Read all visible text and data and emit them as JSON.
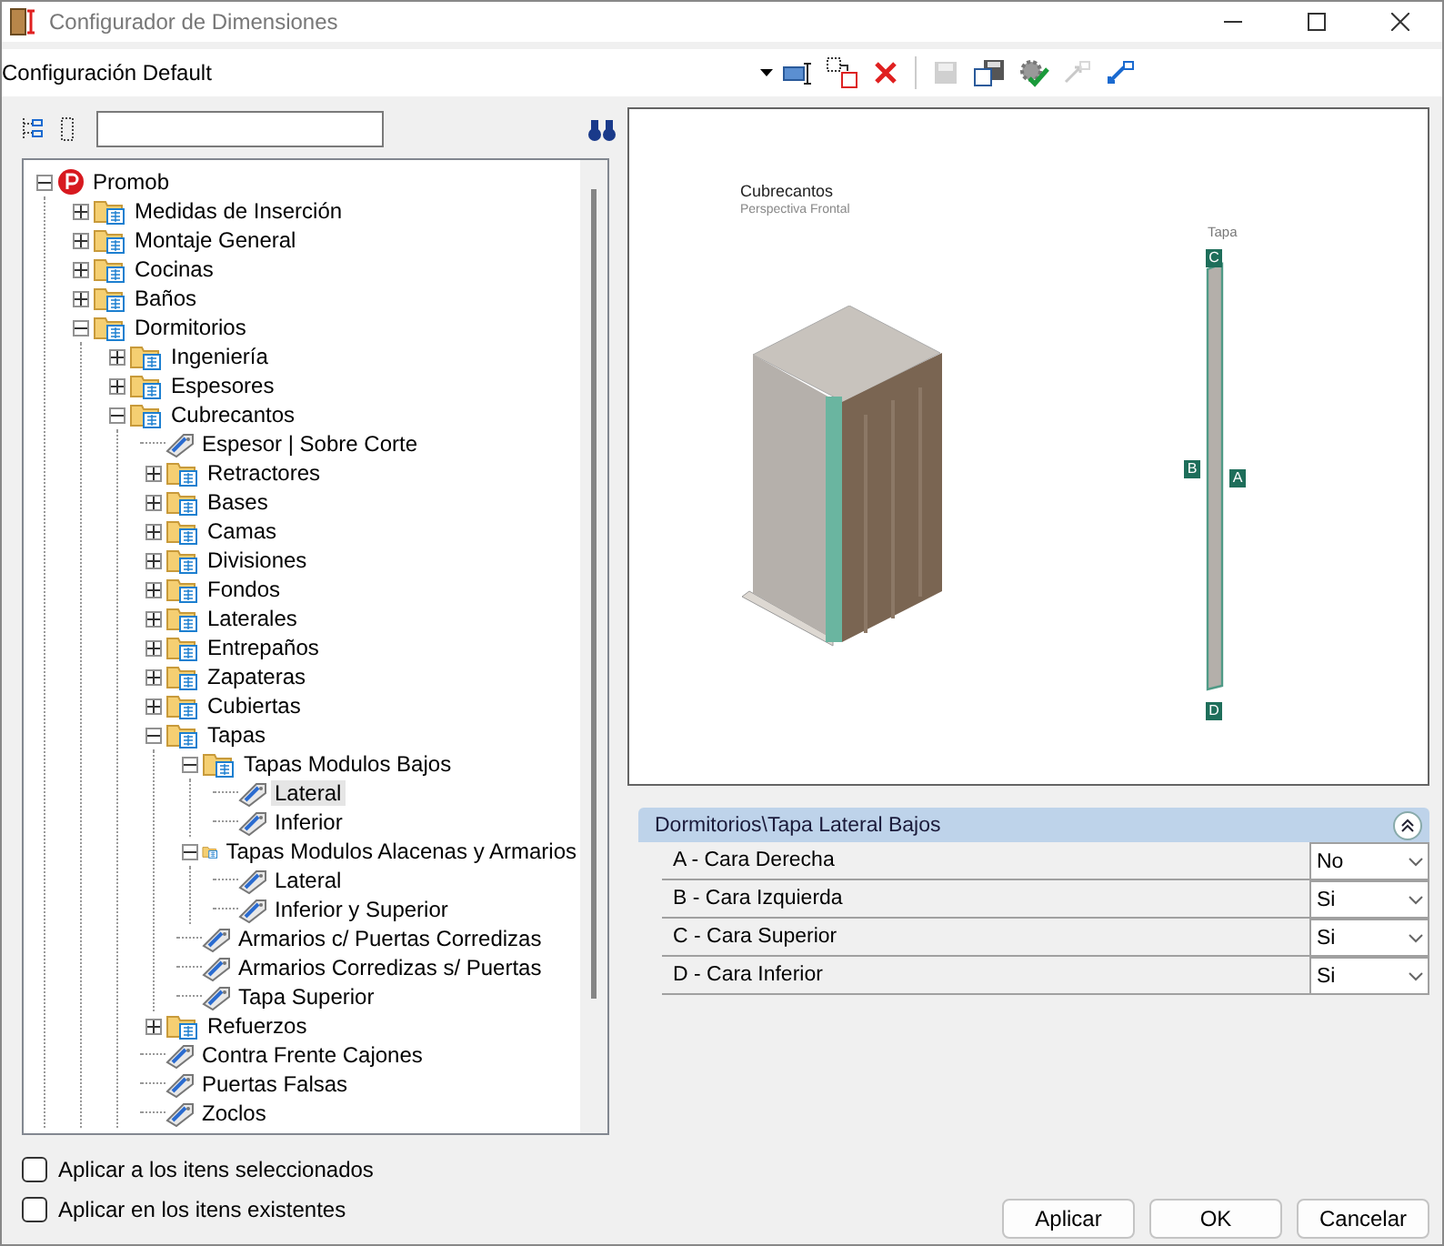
{
  "window": {
    "title": "Configurador de Dimensiones"
  },
  "config_select": {
    "value": "Configuración Default"
  },
  "toolbar": [
    {
      "kind": "rename",
      "disabled": false
    },
    {
      "kind": "copy",
      "disabled": false
    },
    {
      "kind": "delete",
      "disabled": false
    },
    {
      "kind": "save",
      "disabled": true
    },
    {
      "kind": "save_as",
      "disabled": false
    },
    {
      "kind": "apply",
      "disabled": false
    },
    {
      "kind": "import",
      "disabled": true
    },
    {
      "kind": "export",
      "disabled": false
    }
  ],
  "tree": [
    {
      "label": "Promob",
      "kind": "root",
      "expanded": true,
      "selected": false,
      "children": [
        {
          "label": "Medidas de Inserción",
          "kind": "folder",
          "expanded": false,
          "selected": false
        },
        {
          "label": "Montaje General",
          "kind": "folder",
          "expanded": false,
          "selected": false
        },
        {
          "label": "Cocinas",
          "kind": "folder",
          "expanded": false,
          "selected": false
        },
        {
          "label": "Baños",
          "kind": "folder",
          "expanded": false,
          "selected": false
        },
        {
          "label": "Dormitorios",
          "kind": "folder",
          "expanded": true,
          "selected": false,
          "children": [
            {
              "label": "Ingeniería",
              "kind": "folder",
              "expanded": false,
              "selected": false
            },
            {
              "label": "Espesores",
              "kind": "folder",
              "expanded": false,
              "selected": false
            },
            {
              "label": "Cubrecantos",
              "kind": "folder",
              "expanded": true,
              "selected": false,
              "children": [
                {
                  "label": "Espesor | Sobre Corte",
                  "kind": "leaf",
                  "selected": false
                },
                {
                  "label": "Retractores",
                  "kind": "folder",
                  "expanded": false,
                  "selected": false
                },
                {
                  "label": "Bases",
                  "kind": "folder",
                  "expanded": false,
                  "selected": false
                },
                {
                  "label": "Camas",
                  "kind": "folder",
                  "expanded": false,
                  "selected": false
                },
                {
                  "label": "Divisiones",
                  "kind": "folder",
                  "expanded": false,
                  "selected": false
                },
                {
                  "label": "Fondos",
                  "kind": "folder",
                  "expanded": false,
                  "selected": false
                },
                {
                  "label": "Laterales",
                  "kind": "folder",
                  "expanded": false,
                  "selected": false
                },
                {
                  "label": "Entrepaños",
                  "kind": "folder",
                  "expanded": false,
                  "selected": false
                },
                {
                  "label": "Zapateras",
                  "kind": "folder",
                  "expanded": false,
                  "selected": false
                },
                {
                  "label": "Cubiertas",
                  "kind": "folder",
                  "expanded": false,
                  "selected": false
                },
                {
                  "label": "Tapas",
                  "kind": "folder",
                  "expanded": true,
                  "selected": false,
                  "children": [
                    {
                      "label": "Tapas Modulos Bajos",
                      "kind": "folder",
                      "expanded": true,
                      "selected": false,
                      "children": [
                        {
                          "label": "Lateral",
                          "kind": "leaf",
                          "selected": true
                        },
                        {
                          "label": "Inferior",
                          "kind": "leaf",
                          "selected": false
                        }
                      ]
                    },
                    {
                      "label": "Tapas Modulos Alacenas y Armarios",
                      "kind": "folder",
                      "expanded": true,
                      "selected": false,
                      "children": [
                        {
                          "label": "Lateral",
                          "kind": "leaf",
                          "selected": false
                        },
                        {
                          "label": "Inferior y Superior",
                          "kind": "leaf",
                          "selected": false
                        }
                      ]
                    },
                    {
                      "label": "Armarios c/ Puertas Corredizas",
                      "kind": "leaf",
                      "selected": false
                    },
                    {
                      "label": "Armarios Corredizas s/ Puertas",
                      "kind": "leaf",
                      "selected": false
                    },
                    {
                      "label": "Tapa Superior",
                      "kind": "leaf",
                      "selected": false
                    }
                  ]
                },
                {
                  "label": "Refuerzos",
                  "kind": "folder",
                  "expanded": false,
                  "selected": false
                },
                {
                  "label": "Contra Frente Cajones",
                  "kind": "leaf",
                  "selected": false
                },
                {
                  "label": "Puertas Falsas",
                  "kind": "leaf",
                  "selected": false
                },
                {
                  "label": "Zoclos",
                  "kind": "leaf",
                  "selected": false
                }
              ]
            }
          ]
        }
      ]
    }
  ],
  "options": [
    {
      "label": "Aplicar a los itens seleccionados",
      "checked": false
    },
    {
      "label": "Aplicar en los itens existentes",
      "checked": false
    }
  ],
  "preview": {
    "title": "Cubrecantos",
    "subtitle": "Perspectiva Frontal",
    "part_label": "Tapa",
    "edge_labels": [
      {
        "letter": "C",
        "kind": "top"
      },
      {
        "letter": "B",
        "kind": "left"
      },
      {
        "letter": "A",
        "kind": "right"
      },
      {
        "letter": "D",
        "kind": "bottom"
      }
    ]
  },
  "properties": {
    "header": "Dormitorios\\Tapa Lateral Bajos",
    "expanded": true,
    "rows": [
      {
        "label": "A - Cara Derecha",
        "value": "No"
      },
      {
        "label": "B - Cara Izquierda",
        "value": "Si"
      },
      {
        "label": "C - Cara Superior",
        "value": "Si"
      },
      {
        "label": "D - Cara Inferior",
        "value": "Si"
      }
    ]
  },
  "buttons": [
    "Aplicar",
    "OK",
    "Cancelar"
  ]
}
